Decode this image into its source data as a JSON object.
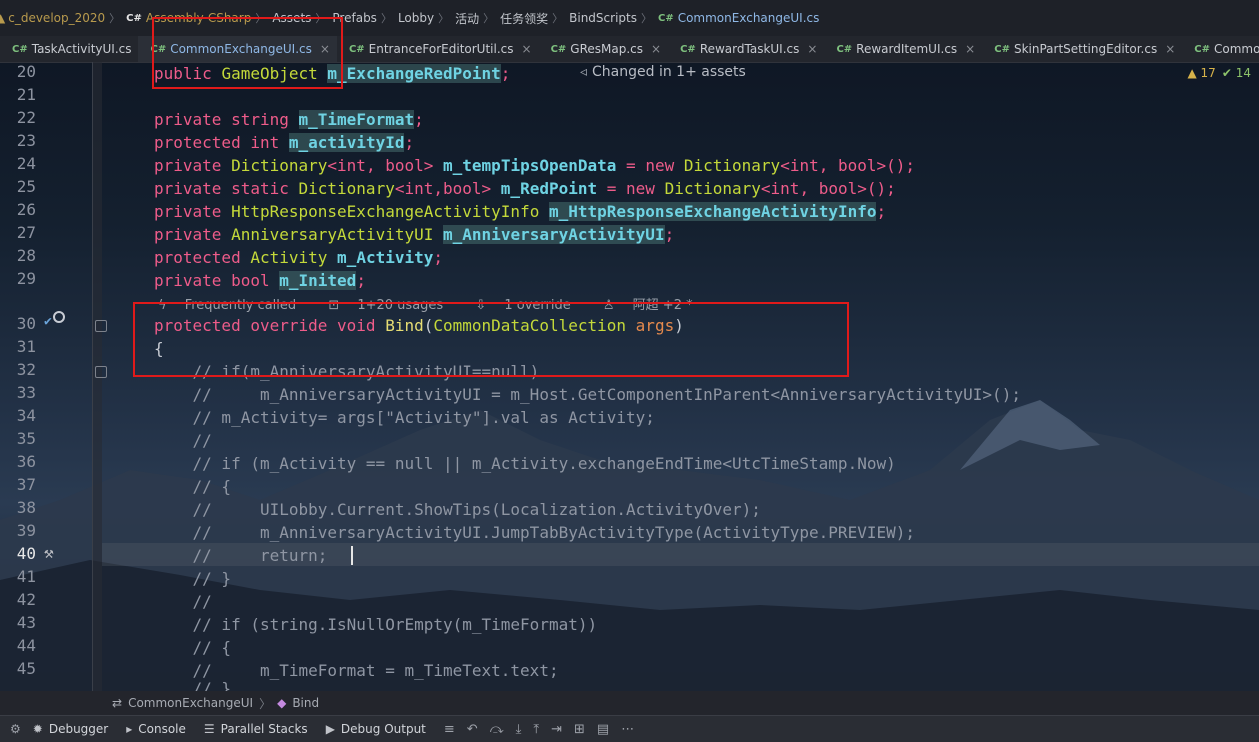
{
  "breadcrumb": [
    {
      "label": "c_develop_2020",
      "dim": true,
      "icon": "folder-icon"
    },
    {
      "label": "Assembly-CSharp",
      "dim": true,
      "icon": "csharp-project-icon"
    },
    {
      "label": "Assets",
      "dim": false,
      "icon": ""
    },
    {
      "label": "Prefabs",
      "dim": false,
      "icon": ""
    },
    {
      "label": "Lobby",
      "dim": false,
      "icon": ""
    },
    {
      "label": "活动",
      "dim": false,
      "icon": ""
    },
    {
      "label": "任务领奖",
      "dim": false,
      "icon": ""
    },
    {
      "label": "BindScripts",
      "dim": false,
      "icon": ""
    },
    {
      "label": "CommonExchangeUI.cs",
      "dim": false,
      "icon": "csharp-file-icon"
    }
  ],
  "tabs": [
    {
      "label": "TaskActivityUI.cs",
      "active": false
    },
    {
      "label": "CommonExchangeUI.cs",
      "active": true
    },
    {
      "label": "EntranceForEditorUtil.cs",
      "active": false
    },
    {
      "label": "GResMap.cs",
      "active": false
    },
    {
      "label": "RewardTaskUI.cs",
      "active": false
    },
    {
      "label": "RewardItemUI.cs",
      "active": false
    },
    {
      "label": "SkinPartSettingEditor.cs",
      "active": false
    },
    {
      "label": "CommonTask",
      "active": false
    }
  ],
  "tab_prefix": "C#",
  "tab_close": "×",
  "editor": {
    "changed_hint": "Changed in 1+ assets",
    "warnings": "17",
    "ok_count": "14",
    "hint": {
      "called": "Frequently called",
      "usages": "1+20 usages",
      "override": "1 override",
      "author": "阿超 +2 *"
    },
    "line_numbers": [
      "20",
      "21",
      "22",
      "23",
      "24",
      "25",
      "26",
      "27",
      "28",
      "29",
      "30",
      "31",
      "32",
      "33",
      "34",
      "35",
      "36",
      "37",
      "38",
      "39",
      "40",
      "41",
      "42",
      "43",
      "44",
      "45"
    ],
    "lines": {
      "l20_a": "public",
      "l20_b": "GameObject",
      "l20_c": "m_ExchangeRedPoint",
      "l22_a": "private",
      "l22_b": "string",
      "l22_c": "m_TimeFormat",
      "l23_a": "protected",
      "l23_b": "int",
      "l23_c": "m_activityId",
      "l24_a": "private",
      "l24_b": "Dictionary",
      "l24_c": "<int, bool>",
      "l24_d": "m_tempTipsOpenData",
      "l24_e": "= ",
      "l24_f": "new",
      "l24_g": "Dictionary",
      "l24_h": "<int, bool>();",
      "l25_a": "private static",
      "l25_b": "Dictionary",
      "l25_c": "<int,bool>",
      "l25_d": "m_RedPoint",
      "l25_e": "= ",
      "l25_f": "new",
      "l25_g": "Dictionary",
      "l25_h": "<int, bool>();",
      "l26_a": "private",
      "l26_b": "HttpResponseExchangeActivityInfo",
      "l26_c": "m_HttpResponseExchangeActivityInfo",
      "l27_a": "private",
      "l27_b": "AnniversaryActivityUI",
      "l27_c": "m_AnniversaryActivityUI",
      "l28_a": "protected",
      "l28_b": "Activity",
      "l28_c": "m_Activity",
      "l29_a": "private",
      "l29_b": "bool",
      "l29_c": "m_Inited",
      "l30_a": "protected override void",
      "l30_b": "Bind",
      "l30_c": "(",
      "l30_d": "CommonDataCollection",
      "l30_e": "args",
      "l30_f": ")",
      "l31": "{",
      "l32": "    // if(m_AnniversaryActivityUI==null)",
      "l33": "    //     m_AnniversaryActivityUI = m_Host.GetComponentInParent<AnniversaryActivityUI>();",
      "l34": "    // m_Activity= args[\"Activity\"].val as Activity;",
      "l35": "    //",
      "l36": "    // if (m_Activity == null || m_Activity.exchangeEndTime<UtcTimeStamp.Now)",
      "l37": "    // {",
      "l38": "    //     UILobby.Current.ShowTips(Localization.ActivityOver);",
      "l39": "    //     m_AnniversaryActivityUI.JumpTabByActivityType(ActivityType.PREVIEW);",
      "l40": "    //     return;",
      "l41": "    // }",
      "l42": "    //",
      "l43": "    // if (string.IsNullOrEmpty(m_TimeFormat))",
      "l44": "    // {",
      "l45": "    //     m_TimeFormat = m_TimeText.text;",
      "l46": "    // }"
    }
  },
  "nav_bottom": {
    "class": "CommonExchangeUI",
    "method": "Bind"
  },
  "toolbar": [
    {
      "label": "Debugger",
      "icon": "bug-icon"
    },
    {
      "label": "Console",
      "icon": "console-icon"
    },
    {
      "label": "Parallel Stacks",
      "icon": "parallel-stacks-icon"
    },
    {
      "label": "Debug Output",
      "icon": "debug-output-icon"
    }
  ]
}
